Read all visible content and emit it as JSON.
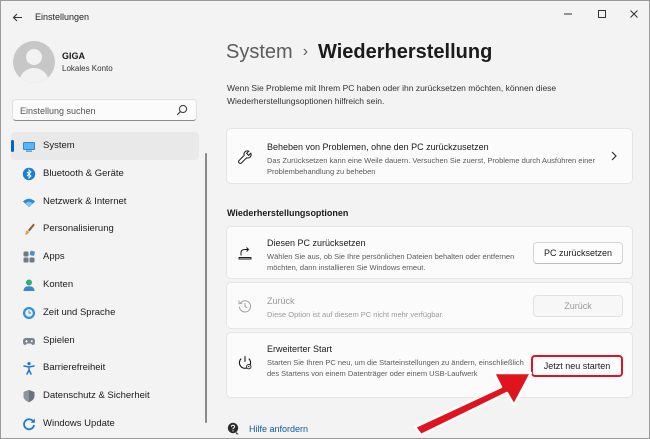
{
  "window": {
    "title": "Einstellungen",
    "back_icon": "arrow-left-icon",
    "controls": [
      "minimize-icon",
      "maximize-icon",
      "close-icon"
    ]
  },
  "user": {
    "name": "GIGA",
    "account_type": "Lokales Konto"
  },
  "search": {
    "placeholder": "Einstellung suchen",
    "value": ""
  },
  "sidebar": {
    "items": [
      {
        "label": "System",
        "icon": "monitor-icon",
        "active": true
      },
      {
        "label": "Bluetooth & Geräte",
        "icon": "bluetooth-icon"
      },
      {
        "label": "Netzwerk & Internet",
        "icon": "wifi-icon"
      },
      {
        "label": "Personalisierung",
        "icon": "brush-icon"
      },
      {
        "label": "Apps",
        "icon": "apps-icon"
      },
      {
        "label": "Konten",
        "icon": "person-icon"
      },
      {
        "label": "Zeit und Sprache",
        "icon": "globe-clock-icon"
      },
      {
        "label": "Spielen",
        "icon": "gamepad-icon"
      },
      {
        "label": "Barrierefreiheit",
        "icon": "accessibility-icon"
      },
      {
        "label": "Datenschutz & Sicherheit",
        "icon": "shield-icon"
      },
      {
        "label": "Windows Update",
        "icon": "update-icon"
      }
    ]
  },
  "main": {
    "breadcrumb_parent": "System",
    "breadcrumb_separator": "›",
    "breadcrumb_current": "Wiederherstellung",
    "intro": "Wenn Sie Probleme mit Ihrem PC haben oder ihn zurücksetzen möchten, können diese Wiederherstellungsoptionen hilfreich sein.",
    "troubleshoot_card": {
      "title": "Beheben von Problemen, ohne den PC zurückzusetzen",
      "description": "Das Zurücksetzen kann eine Weile dauern. Versuchen Sie zuerst, Probleme durch Ausführen einer Problembehandlung zu beheben",
      "icon": "wrench-icon"
    },
    "section_title": "Wiederherstellungsoptionen",
    "options": [
      {
        "title": "Diesen PC zurücksetzen",
        "description": "Wählen Sie aus, ob Sie Ihre persönlichen Dateien behalten oder entfernen möchten, dann installieren Sie Windows erneut.",
        "button": "PC zurücksetzen",
        "icon": "reset-pc-icon"
      },
      {
        "title": "Zurück",
        "description": "Diese Option ist auf diesem PC nicht mehr verfügbar.",
        "button": "Zurück",
        "icon": "history-icon",
        "disabled": true
      },
      {
        "title": "Erweiterter Start",
        "description": "Starten Sie Ihren PC neu, um die Starteinstellungen zu ändern, einschließlich des Startens von einem Datenträger oder einem USB-Laufwerk",
        "button": "Jetzt neu starten",
        "icon": "advanced-startup-icon",
        "highlighted": true
      }
    ],
    "help_link": "Hilfe anfordern",
    "help_icon": "help-icon"
  },
  "colors": {
    "accent": "#0067c0",
    "highlight_border": "#e0141e",
    "annotation_arrow": "#e0141e",
    "link": "#0b5cad",
    "background": "#f3f3f3",
    "card": "#fbfbfb"
  }
}
